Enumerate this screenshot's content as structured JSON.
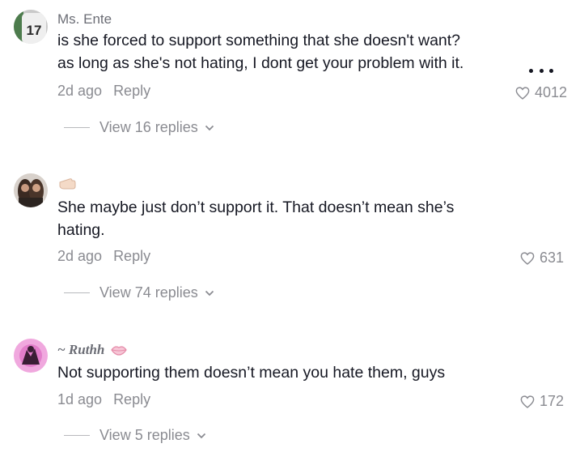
{
  "comments": [
    {
      "username": "Ms. Ente",
      "text_lines": [
        "is she forced to support something that she doesn't want?",
        "as long as she's not hating, I dont get your problem with it."
      ],
      "time": "2d ago",
      "reply_label": "Reply",
      "likes": "4012",
      "view_replies": "View 16 replies",
      "avatar_number": "17"
    },
    {
      "username_icon": "hand-emoji-icon",
      "text_lines": [
        "She maybe just don’t support it. That doesn’t mean she’s",
        "hating."
      ],
      "time": "2d ago",
      "reply_label": "Reply",
      "likes": "631",
      "view_replies": "View 74 replies"
    },
    {
      "username": "~ Ruthh",
      "username_icon": "lips-emoji-icon",
      "text_lines": [
        "Not supporting them doesn’t mean you hate them, guys"
      ],
      "time": "1d ago",
      "reply_label": "Reply",
      "likes": "172",
      "view_replies": "View 5 replies"
    }
  ],
  "more_icon": "more-dots-icon",
  "heart_icon": "heart-outline-icon",
  "chevron_icon": "chevron-down-icon"
}
